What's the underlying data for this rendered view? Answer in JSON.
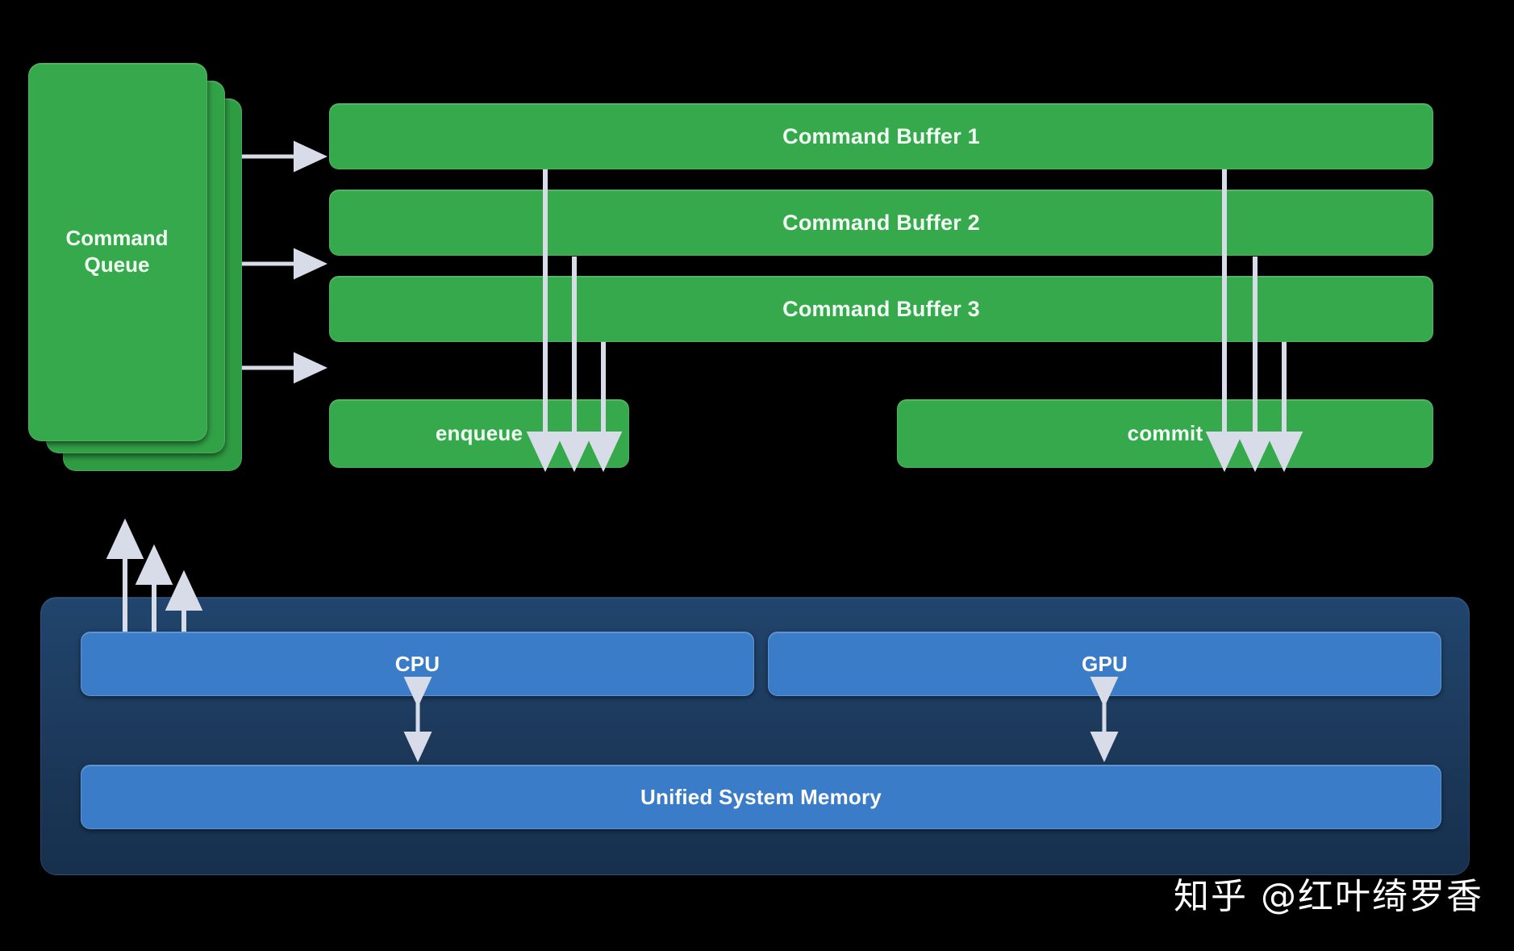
{
  "meta": {
    "title": "Metal Command Queue / Command Buffer architecture diagram",
    "background_color": "#000000"
  },
  "palette": {
    "green": "#35a94b",
    "blue": "#3a7cc8",
    "panel_dark_blue": "#1d3a5c",
    "arrow": "#d8dce8",
    "text_light": "#f2fff4"
  },
  "command_queue": {
    "label": "Command\nQueue",
    "label_line1": "Command",
    "label_line2": "Queue",
    "stack_count": 3
  },
  "command_buffers": [
    {
      "label": "Command Buffer 1"
    },
    {
      "label": "Command Buffer 2"
    },
    {
      "label": "Command Buffer 3"
    }
  ],
  "operations": {
    "enqueue_label": "enqueue",
    "commit_label": "commit"
  },
  "system_panel": {
    "cpu_label": "CPU",
    "gpu_label": "GPU",
    "memory_label": "Unified System Memory"
  },
  "connections": {
    "queue_to_buffers": 3,
    "buffers_to_enqueue": 3,
    "buffers_to_commit": 3,
    "cpu_to_queue": 3,
    "cpu_memory_bidirectional": true,
    "gpu_memory_bidirectional": true
  },
  "watermark": {
    "text": "知乎 @红叶绮罗香"
  }
}
